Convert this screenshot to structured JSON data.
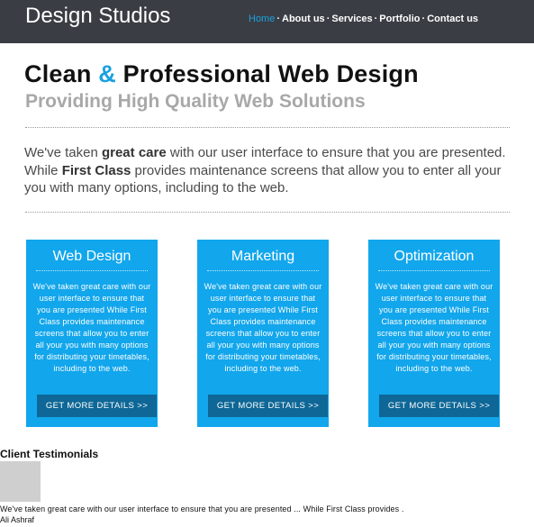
{
  "header": {
    "brand": "Design Studios",
    "nav": [
      {
        "label": "Home",
        "active": true
      },
      {
        "label": "About us",
        "active": false
      },
      {
        "label": "Services",
        "active": false
      },
      {
        "label": "Portfolio",
        "active": false
      },
      {
        "label": "Contact us",
        "active": false
      }
    ],
    "nav_separator": "·"
  },
  "hero": {
    "title_part1": "Clean ",
    "title_amp": "&",
    "title_part2": " Professional Web Design",
    "subtitle": "Providing High Quality Web Solutions"
  },
  "intro": {
    "t1": "We've taken ",
    "b1": "great care",
    "t2": " with our user interface to ensure that you are presented. While ",
    "b2": "First Class",
    "t3": " provides maintenance screens that allow you to enter all your you with many options, including to the web."
  },
  "cards": [
    {
      "title": "Web Design",
      "text": "We've taken great care with our user interface to ensure that you are presented While First Class provides maintenance screens that allow you to enter all your you with many options for distributing your timetables, including to the web.",
      "button": "GET MORE DETAILS >>"
    },
    {
      "title": "Marketing",
      "text": "We've taken great care with our user interface to ensure that you are presented While First Class provides maintenance screens that allow you to enter all your you with many options for distributing your timetables, including to the web.",
      "button": "GET MORE DETAILS >>"
    },
    {
      "title": "Optimization",
      "text": "We've taken great care with our user interface to ensure that you are presented While First Class provides maintenance screens that allow you to enter all your you with many options for distributing your timetables, including to the web.",
      "button": "GET MORE DETAILS >>"
    }
  ],
  "testimonials": {
    "heading": "Client Testimonials",
    "quote": "We've taken great care with our user interface to ensure that you are presented ... While First Class provides .",
    "author": "Ali Ashraf"
  },
  "colors": {
    "header_bg": "#3a3e44",
    "accent": "#1aa0e0",
    "card_bg": "#12a6ec",
    "button_bg": "#0e6796"
  }
}
